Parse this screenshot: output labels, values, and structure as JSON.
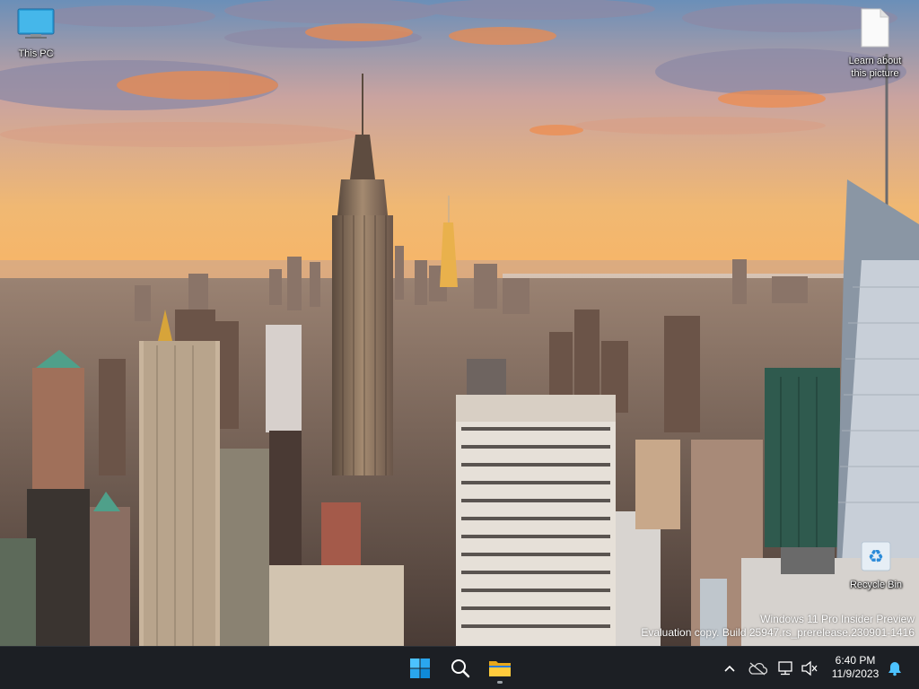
{
  "desktop": {
    "icons": [
      {
        "label": "This PC",
        "icon": "monitor-icon"
      },
      {
        "label": "Learn about\nthis picture",
        "icon": "document-icon"
      },
      {
        "label": "Recycle Bin",
        "icon": "recycle-bin-icon"
      }
    ],
    "watermark": {
      "line1": "Windows 11 Pro Insider Preview",
      "line2": "Evaluation copy. Build 25947.rs_prerelease.230901-1416"
    }
  },
  "taskbar": {
    "apps": [
      {
        "name": "Start",
        "icon": "windows-logo-icon"
      },
      {
        "name": "Search",
        "icon": "search-icon"
      },
      {
        "name": "File Explorer",
        "icon": "folder-icon",
        "running": true
      }
    ],
    "tray": {
      "icons": [
        "chevron-up-icon",
        "onedrive-cloud-icon",
        "network-icon",
        "volume-muted-icon",
        "bell-icon"
      ],
      "time": "6:40 PM",
      "date": "11/9/2023"
    },
    "colors": {
      "background": "#1c1f24",
      "accent": "#0078d4"
    }
  }
}
